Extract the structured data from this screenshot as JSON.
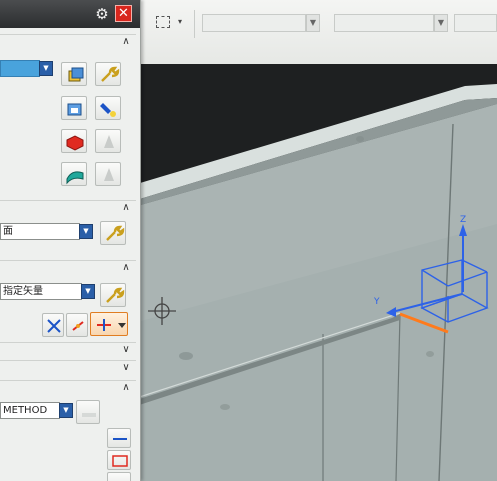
{
  "window": {
    "title_icons": [
      "gear-icon",
      "close-icon"
    ],
    "settings_glyph": "⚙",
    "close_glyph": "✕"
  },
  "panel": {
    "sections": [
      {
        "name": "object",
        "collapse_glyph": "∧"
      },
      {
        "name": "face",
        "collapse_glyph": "∧",
        "dropdown_value": "面"
      },
      {
        "name": "vector",
        "collapse_glyph": "∧",
        "dropdown_value": "指定矢量"
      },
      {
        "name": "collapsed-1",
        "collapse_glyph": "∨"
      },
      {
        "name": "collapsed-2",
        "collapse_glyph": "∨"
      },
      {
        "name": "method",
        "collapse_glyph": "∧",
        "dropdown_value": "METHOD"
      }
    ],
    "dropdown_arrow_glyph": "▼"
  },
  "toolbar": {
    "filter_placeholder": "",
    "caret_glyph": "▾",
    "arrow_glyph": "▼"
  },
  "viewport": {
    "axis_labels": {
      "z": "Z",
      "y": "Y"
    },
    "colors": {
      "part_face": "#a7b2b1",
      "axis_blue": "#2d62e8",
      "axis_orange": "#ff7b1c",
      "selection_red": "#e02a20",
      "dialog_selected_blue": "#49a3dc"
    }
  }
}
